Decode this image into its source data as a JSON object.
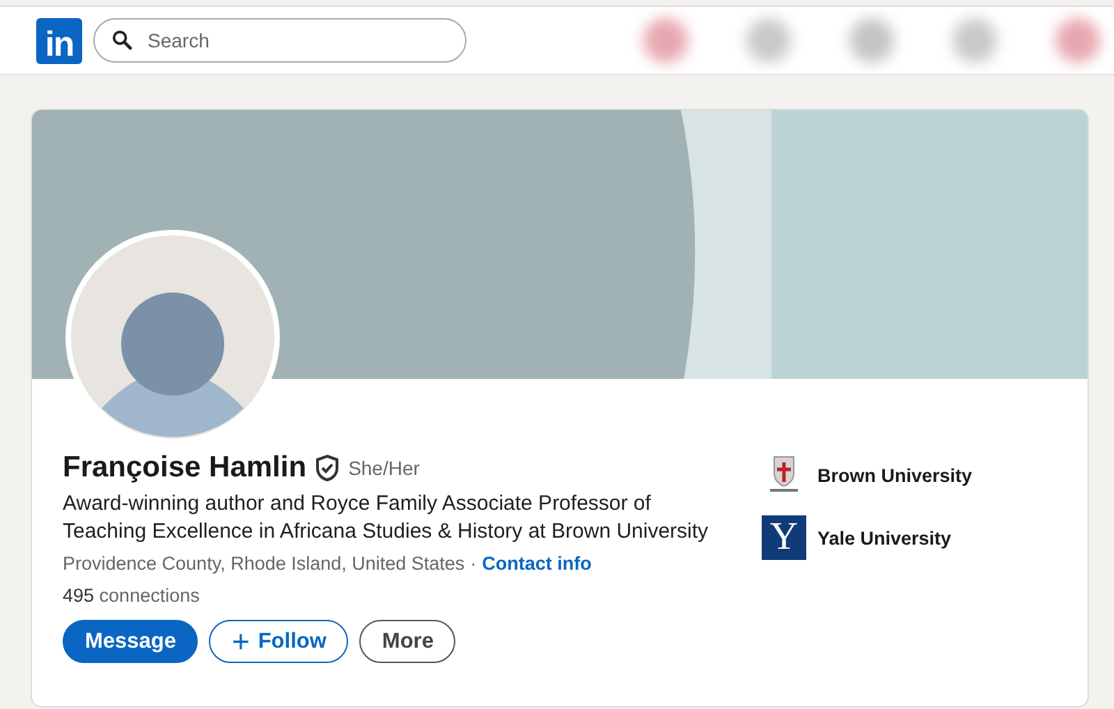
{
  "header": {
    "logo": "in",
    "search": {
      "placeholder": "Search"
    }
  },
  "profile": {
    "name": "Françoise Hamlin",
    "pronouns": "She/Her",
    "verified": true,
    "headline": "Award-winning author and Royce Family Associate Professor of Teaching Excellence in Africana Studies & History at Brown University",
    "location": "Providence County, Rhode Island, United States",
    "separator": "·",
    "contact_link": "Contact info",
    "connections_count": "495",
    "connections_label": "connections",
    "buttons": [
      {
        "kind": "primary",
        "label": "Message"
      },
      {
        "kind": "outline",
        "icon": "+",
        "label": "Follow"
      },
      {
        "kind": "neutral",
        "label": "More"
      }
    ],
    "education": [
      {
        "kind": "shield",
        "name": "Brown University"
      },
      {
        "kind": "letter",
        "logo_text": "Y",
        "name": "Yale University"
      }
    ]
  }
}
